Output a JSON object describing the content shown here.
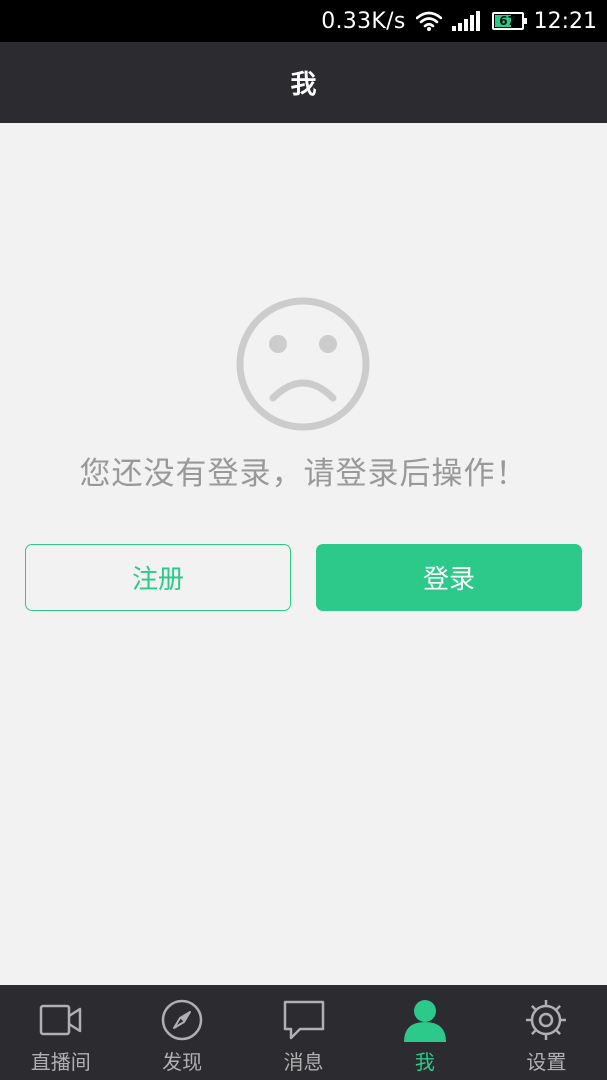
{
  "status_bar": {
    "speed": "0.33K/s",
    "battery": "67",
    "battery_level": 0.67,
    "time": "12:21"
  },
  "header": {
    "title": "我"
  },
  "main": {
    "message": "您还没有登录，请登录后操作！",
    "register_label": "注册",
    "login_label": "登录"
  },
  "nav": {
    "items": [
      {
        "label": "直播间",
        "icon": "video-camera-icon",
        "active": false
      },
      {
        "label": "发现",
        "icon": "compass-icon",
        "active": false
      },
      {
        "label": "消息",
        "icon": "chat-bubble-icon",
        "active": false
      },
      {
        "label": "我",
        "icon": "user-icon",
        "active": true
      },
      {
        "label": "设置",
        "icon": "gear-icon",
        "active": false
      }
    ]
  },
  "colors": {
    "accent": "#2cc98b",
    "header_bg": "#2b2b30",
    "background": "#f2f2f2",
    "face": "#cccccc",
    "message_text": "#999999",
    "nav_inactive": "#b0b0b0"
  }
}
